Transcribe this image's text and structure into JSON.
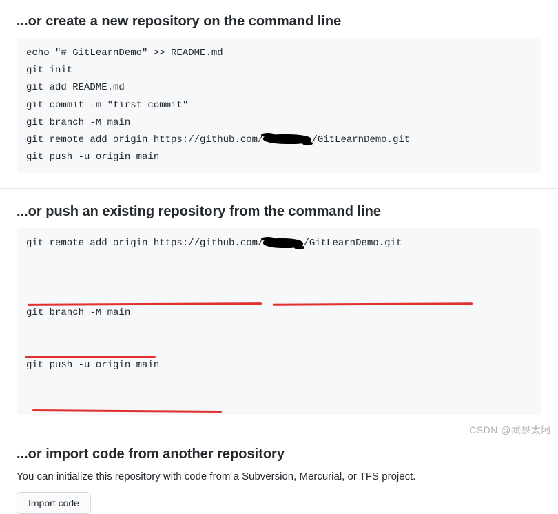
{
  "section1": {
    "heading": "...or create a new repository on the command line",
    "code": {
      "l1a": "echo \"# GitLearnDemo\" >> README.md",
      "l2a": "git init",
      "l3a": "git add README.md",
      "l4a": "git commit -m \"first commit\"",
      "l5a": "git branch -M main",
      "l6a_pre": "git remote add origin https://github.com/",
      "l6a_post": "/GitLearnDemo.git",
      "l7a": "git push -u origin main"
    }
  },
  "section2": {
    "heading": "...or push an existing repository from the command line",
    "code": {
      "l1b_pre": "git remote add origin https://github.com/",
      "l1b_post": "/GitLearnDemo.git",
      "l2b": "git branch -M main",
      "l3b": "git push -u origin main"
    }
  },
  "section3": {
    "heading": "...or import code from another repository",
    "desc": "You can initialize this repository with code from a Subversion, Mercurial, or TFS project.",
    "button": "Import code"
  },
  "watermark": "CSDN @龙泉太阿"
}
